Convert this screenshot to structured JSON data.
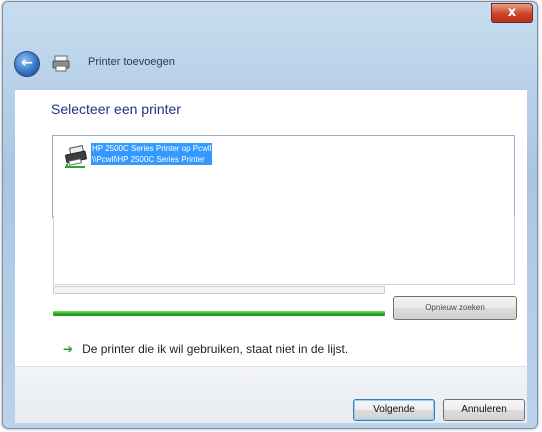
{
  "window": {
    "title": "Printer toevoegen",
    "close_label": "x"
  },
  "nav": {
    "back_label": "←"
  },
  "main": {
    "heading": "Selecteer een printer",
    "printers": [
      {
        "line1": "HP 2500C Series Printer op Pcwll",
        "line2": "\\\\Pcwll\\HP 2500C Series Printer",
        "selected": true
      }
    ],
    "progress_fraction": 1.0,
    "search_again_label": "Opnieuw zoeken",
    "not_listed_arrow": "➔",
    "not_listed_link": "De printer die ik wil gebruiken, staat niet in de lijst."
  },
  "footer": {
    "next_label": "Volgende",
    "cancel_label": "Annuleren"
  },
  "colors": {
    "accent": "#1e3287",
    "selection": "#3399ff",
    "progress": "#2ea81f"
  },
  "icons": {
    "back": "back-arrow-icon",
    "printer": "printer-icon",
    "close": "close-icon",
    "arrow": "green-arrow-icon"
  }
}
